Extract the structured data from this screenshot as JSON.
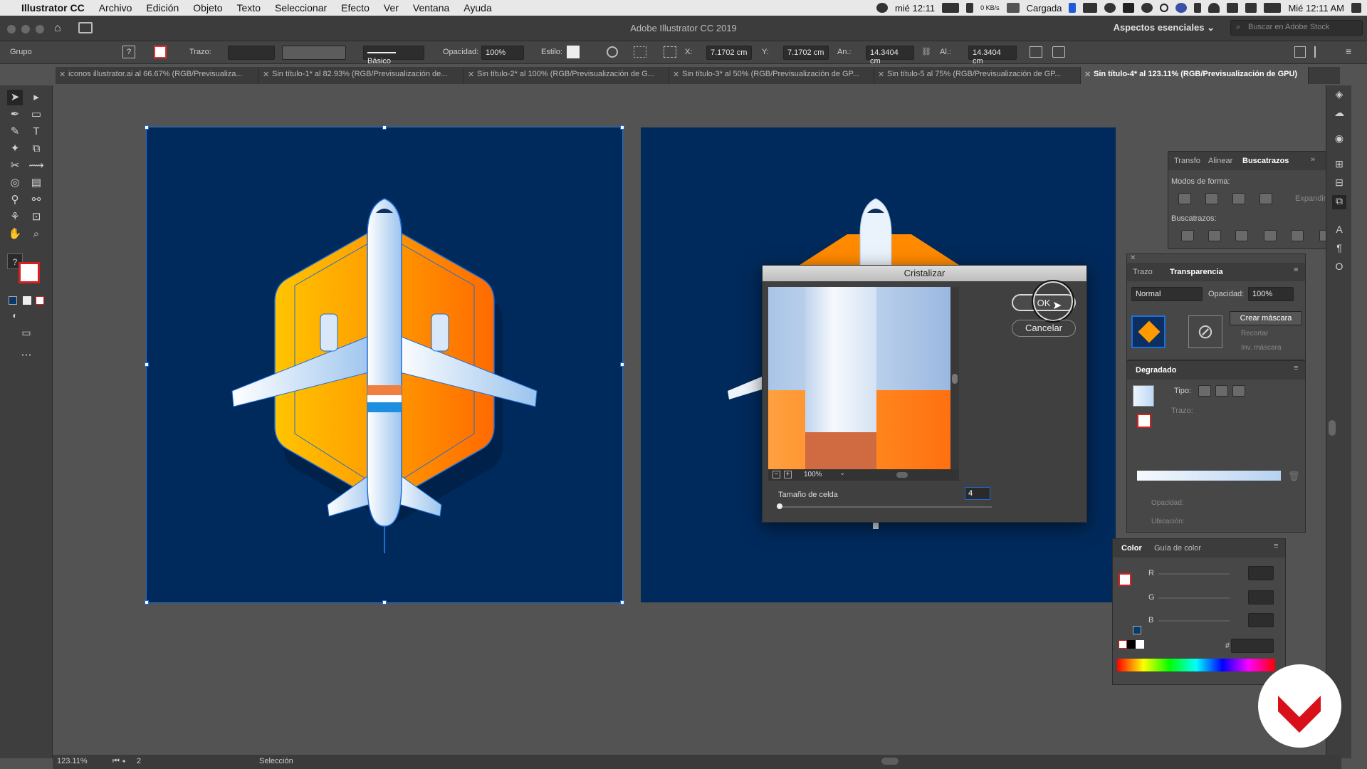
{
  "menubar": {
    "app_name": "Illustrator CC",
    "items": [
      "Archivo",
      "Edición",
      "Objeto",
      "Texto",
      "Seleccionar",
      "Efecto",
      "Ver",
      "Ventana",
      "Ayuda"
    ],
    "status": {
      "date_short": "mié 12:11",
      "net": "0 KB/s",
      "battery": "Cargada",
      "clock": "Mié 12:11 AM"
    }
  },
  "window": {
    "title": "Adobe Illustrator CC 2019",
    "workspace": "Aspectos esenciales",
    "stock_search_placeholder": "Buscar en Adobe Stock"
  },
  "controlbar": {
    "selection_type": "Grupo",
    "stroke_label": "Trazo:",
    "brush_label": "Básico",
    "opacity_label": "Opacidad:",
    "opacity_value": "100%",
    "style_label": "Estilo:",
    "x_label": "X:",
    "x_value": "7.1702 cm",
    "y_label": "Y:",
    "y_value": "7.1702 cm",
    "w_label": "An.:",
    "w_value": "14.3404 cm",
    "h_label": "Al.:",
    "h_value": "14.3404 cm"
  },
  "tabs": [
    {
      "label": "iconos illustrator.ai al 66.67% (RGB/Previsualiza...",
      "active": false
    },
    {
      "label": "Sin título-1* al 82.93% (RGB/Previsualización de...",
      "active": false
    },
    {
      "label": "Sin título-2* al 100% (RGB/Previsualización de G...",
      "active": false
    },
    {
      "label": "Sin título-3* al 50% (RGB/Previsualización de GP...",
      "active": false
    },
    {
      "label": "Sin título-5 al 75% (RGB/Previsualización de GP...",
      "active": false
    },
    {
      "label": "Sin título-4* al 123.11% (RGB/Previsualización de GPU)",
      "active": true
    }
  ],
  "dialog": {
    "title": "Cristalizar",
    "ok_label": "OK",
    "cancel_label": "Cancelar",
    "zoom_label": "100%",
    "cell_size_label": "Tamaño de celda",
    "cell_size_value": "4"
  },
  "pathfinder_panel": {
    "tabs": [
      "Transfo",
      "Alinear",
      "Buscatrazos"
    ],
    "active_tab": "Buscatrazos",
    "shape_modes_label": "Modos de forma:",
    "expand_label": "Expandir",
    "pathfinders_label": "Buscatrazos:"
  },
  "transparency_panel": {
    "tabs": [
      "Trazo",
      "Transparencia"
    ],
    "active_tab": "Transparencia",
    "blend_mode": "Normal",
    "opacity_label": "Opacidad:",
    "opacity_value": "100%",
    "make_mask_label": "Crear máscara",
    "clip_label": "Recortar",
    "invert_label": "Inv. máscara"
  },
  "gradient_panel": {
    "title": "Degradado",
    "type_label": "Tipo:",
    "stroke_label": "Trazo:",
    "opacity_label": "Opacidad:",
    "location_label": "Ubicación:"
  },
  "color_panel": {
    "tabs": [
      "Color",
      "Guía de color"
    ],
    "active_tab": "Color",
    "channels": [
      "R",
      "G",
      "B"
    ],
    "hex_label": "#"
  },
  "statusbar": {
    "zoom": "123.11%",
    "artboard": "2",
    "tool": "Selección"
  },
  "colors": {
    "artboard_bg": "#002a5c",
    "orange": "#ff8a00",
    "selection_blue": "#1e6ed8",
    "logo_red": "#d8101a"
  }
}
